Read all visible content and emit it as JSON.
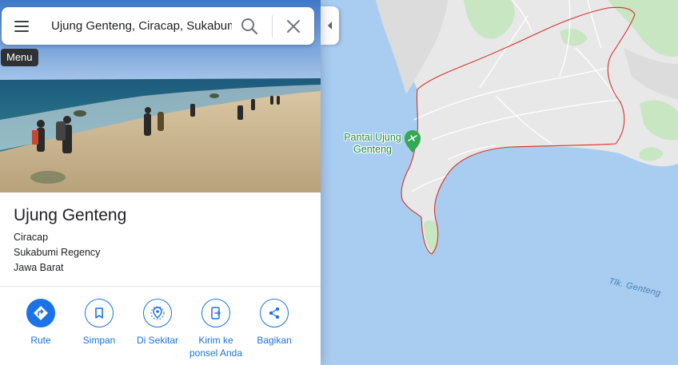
{
  "search": {
    "value": "Ujung Genteng, Ciracap, Sukabumi"
  },
  "tooltip": {
    "label": "Menu"
  },
  "place": {
    "title": "Ujung Genteng",
    "address_lines": [
      "Ciracap",
      "Sukabumi Regency",
      "Jawa Barat"
    ]
  },
  "actions": [
    {
      "label": "Rute",
      "icon": "directions-icon"
    },
    {
      "label": "Simpan",
      "icon": "bookmark-icon"
    },
    {
      "label": "Di Sekitar",
      "icon": "nearby-icon"
    },
    {
      "label": "Kirim ke ponsel Anda",
      "icon": "send-to-phone-icon"
    },
    {
      "label": "Bagikan",
      "icon": "share-icon"
    }
  ],
  "map": {
    "poi_label": "Pantai Ujung Genteng",
    "water_label": "Tlk. Genteng",
    "colors": {
      "water": "#a8cdf0",
      "land": "#e8e8e8",
      "boundary": "#d93025",
      "poi": "#34a853",
      "accent": "#1a73e8"
    }
  }
}
